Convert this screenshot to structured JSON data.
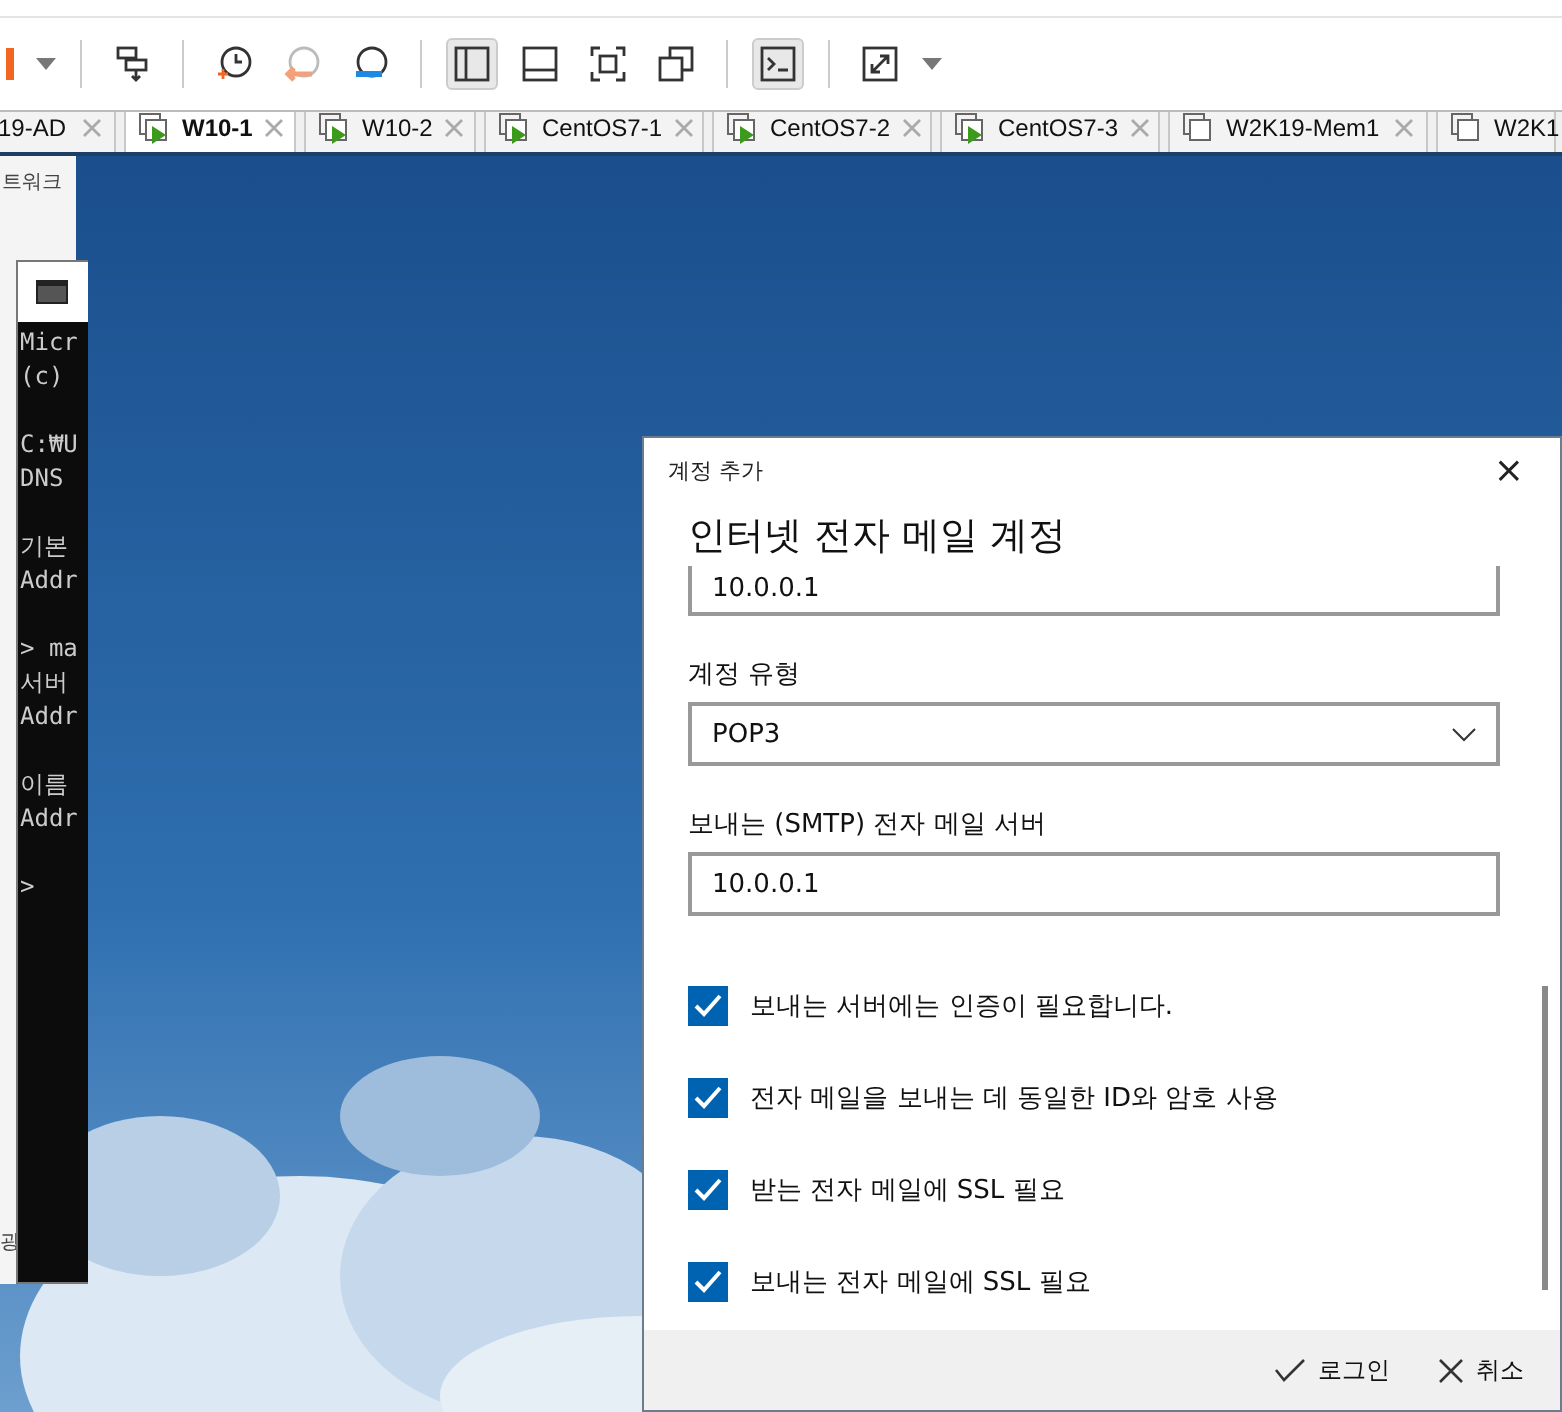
{
  "tabs": [
    {
      "label": "19-AD",
      "selected": false
    },
    {
      "label": "W10-1",
      "selected": true,
      "running": true
    },
    {
      "label": "W10-2",
      "selected": false,
      "running": true
    },
    {
      "label": "CentOS7-1",
      "selected": false,
      "running": true
    },
    {
      "label": "CentOS7-2",
      "selected": false,
      "running": true
    },
    {
      "label": "CentOS7-3",
      "selected": false,
      "running": true
    },
    {
      "label": "W2K19-Mem1",
      "selected": false,
      "running": false
    },
    {
      "label": "W2K1",
      "selected": false,
      "running": false
    }
  ],
  "back_window": {
    "title": "트워크",
    "footer": "광"
  },
  "console": {
    "blocks": [
      [
        "Micr",
        "(c)"
      ],
      [
        "C:₩U",
        "DNS"
      ],
      [
        "기본",
        "Addr"
      ],
      [
        "> ma",
        "서버",
        "Addr"
      ],
      [
        "이름",
        "Addr"
      ],
      [
        ">"
      ]
    ]
  },
  "dialog": {
    "title": "계정 추가",
    "close": "×",
    "heading": "인터넷 전자 메일 계정",
    "fields": [
      {
        "kind": "text",
        "value": "10.0.0.1"
      },
      {
        "kind": "select",
        "label": "계정 유형",
        "value": "POP3"
      },
      {
        "kind": "text",
        "label": "보내는 (SMTP) 전자 메일 서버",
        "value": "10.0.0.1"
      }
    ],
    "checkboxes": [
      {
        "label": "보내는 서버에는 인증이 필요합니다.",
        "checked": true
      },
      {
        "label": "전자 메일을 보내는 데 동일한 ID와 암호 사용",
        "checked": true
      },
      {
        "label": "받는 전자 메일에 SSL 필요",
        "checked": true
      },
      {
        "label": "보내는 전자 메일에 SSL 필요",
        "checked": true
      }
    ],
    "buttons": [
      {
        "kind": "confirm",
        "label": "로그인"
      },
      {
        "kind": "cancel",
        "label": "취소"
      }
    ]
  }
}
